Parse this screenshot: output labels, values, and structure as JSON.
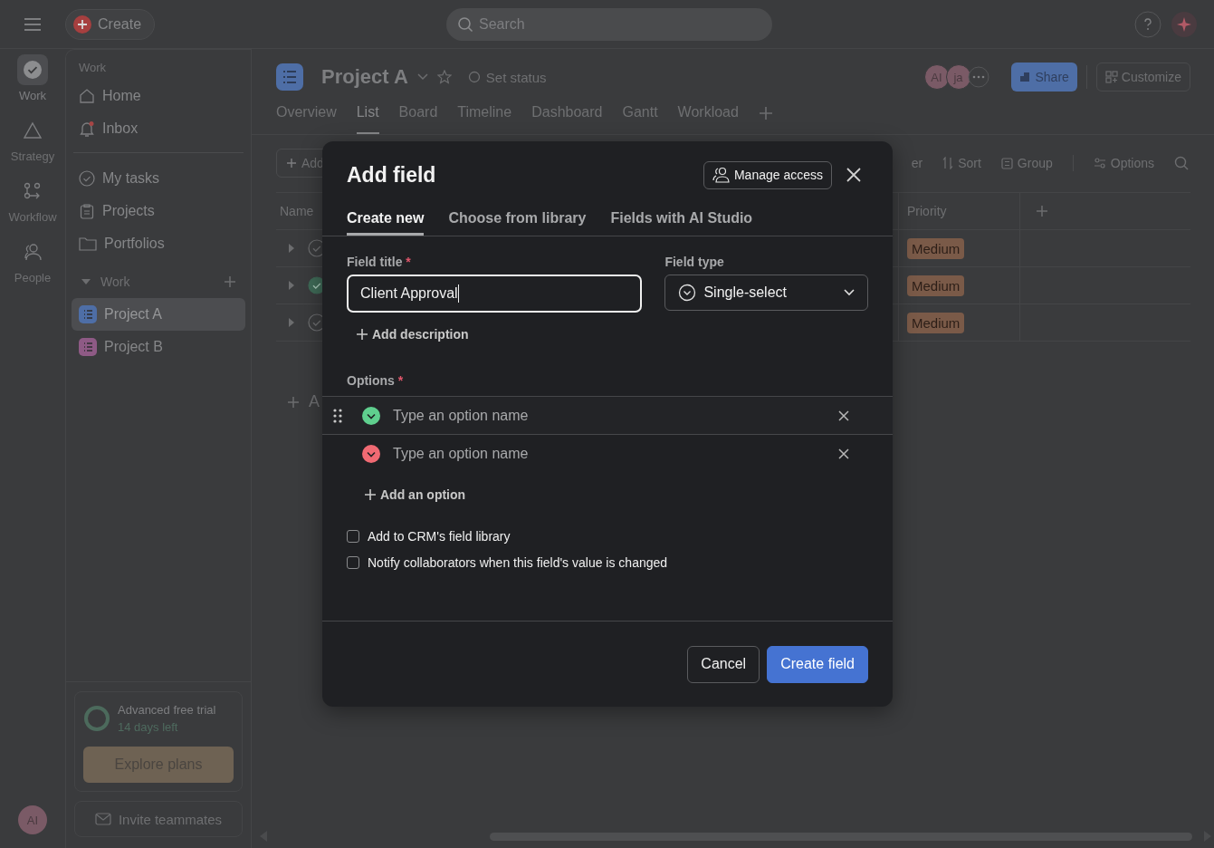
{
  "topbar": {
    "create_label": "Create",
    "search_placeholder": "Search"
  },
  "rail": [
    {
      "label": "Work",
      "selected": true
    },
    {
      "label": "Strategy",
      "selected": false
    },
    {
      "label": "Workflow",
      "selected": false
    },
    {
      "label": "People",
      "selected": false
    }
  ],
  "user_avatar": "AI",
  "sidebar": {
    "heading": "Work",
    "nav": [
      {
        "label": "Home"
      },
      {
        "label": "Inbox"
      }
    ],
    "nav2": [
      {
        "label": "My tasks"
      },
      {
        "label": "Projects"
      },
      {
        "label": "Portfolios"
      }
    ],
    "section": {
      "label": "Work",
      "expanded": true,
      "projects": [
        {
          "label": "Project A",
          "color": "#4e6ea6",
          "selected": true
        },
        {
          "label": "Project B",
          "color": "#8e5a85",
          "selected": false
        }
      ]
    },
    "trial": {
      "title": "Advanced free trial",
      "subtitle": "14 days left",
      "button": "Explore plans"
    },
    "invite": "Invite teammates"
  },
  "project": {
    "title": "Project A",
    "status": "Set status",
    "members": [
      "AI",
      "ja"
    ],
    "share": "Share",
    "customize": "Customize",
    "tabs": [
      {
        "label": "Overview",
        "selected": false
      },
      {
        "label": "List",
        "selected": true
      },
      {
        "label": "Board",
        "selected": false
      },
      {
        "label": "Timeline",
        "selected": false
      },
      {
        "label": "Dashboard",
        "selected": false
      },
      {
        "label": "Gantt",
        "selected": false
      },
      {
        "label": "Workload",
        "selected": false
      }
    ]
  },
  "toolbar": {
    "add": "Add",
    "right": [
      "er",
      "Sort",
      "Group",
      "Options"
    ]
  },
  "table": {
    "columns": [
      "Name",
      "Priority"
    ],
    "rows": [
      {
        "done": false,
        "priority": "Medium"
      },
      {
        "done": true,
        "priority": "Medium"
      },
      {
        "done": false,
        "priority": "Medium"
      }
    ],
    "add_row": "A"
  },
  "modal": {
    "title": "Add field",
    "manage_access": "Manage access",
    "tabs": [
      {
        "label": "Create new",
        "selected": true
      },
      {
        "label": "Choose from library",
        "selected": false
      },
      {
        "label": "Fields with AI Studio",
        "selected": false
      }
    ],
    "field_title": {
      "label": "Field title",
      "required_mark": "*",
      "value": "Client Approval"
    },
    "field_type": {
      "label": "Field type",
      "value": "Single-select"
    },
    "add_description": "Add description",
    "options_label": {
      "label": "Options",
      "required_mark": "*"
    },
    "options": [
      {
        "placeholder": "Type an option name",
        "color": "#5fcf8e",
        "drag_handle": true
      },
      {
        "placeholder": "Type an option name",
        "color": "#f06a73",
        "drag_handle": false
      }
    ],
    "add_option": "Add an option",
    "checkboxes": [
      {
        "label": "Add to CRM's field library",
        "checked": false
      },
      {
        "label": "Notify collaborators when this field's value is changed",
        "checked": false
      }
    ],
    "buttons": [
      {
        "label": "Cancel",
        "kind": "secondary"
      },
      {
        "label": "Create field",
        "kind": "primary"
      }
    ]
  }
}
